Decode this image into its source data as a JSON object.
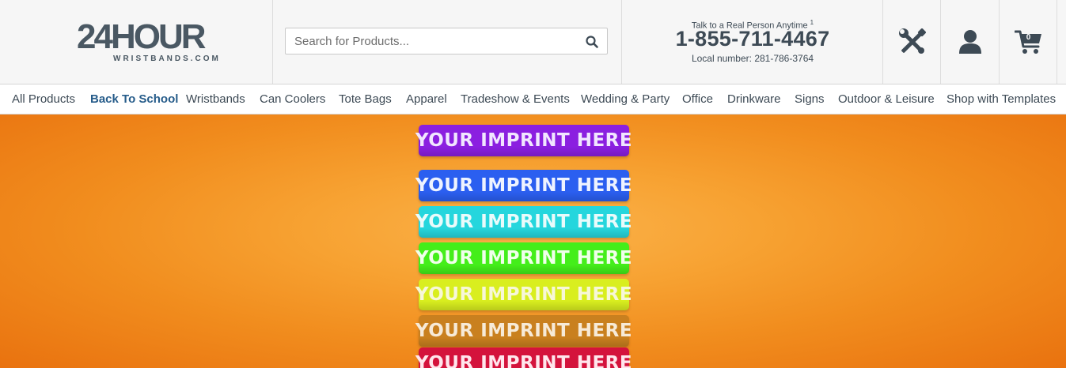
{
  "header": {
    "logo": {
      "main": "24HOUR",
      "sub": "WRISTBANDS.COM"
    },
    "search": {
      "placeholder": "Search for Products..."
    },
    "contact": {
      "tagline": "Talk to a Real Person Anytime",
      "tag_note": "1",
      "phone": "1-855-711-4467",
      "local": "Local number: 281-786-3764"
    },
    "icons": {
      "tools": "tools-icon",
      "account": "user-icon",
      "cart": "cart-icon"
    },
    "cart_count": "0"
  },
  "nav": {
    "items": [
      {
        "label": "All Products"
      },
      {
        "label": "Back To School",
        "active": true
      },
      {
        "label": "Wristbands"
      },
      {
        "label": "Can Coolers"
      },
      {
        "label": "Tote Bags"
      },
      {
        "label": "Apparel"
      },
      {
        "label": "Tradeshow & Events"
      },
      {
        "label": "Wedding & Party"
      },
      {
        "label": "Office"
      },
      {
        "label": "Drinkware"
      },
      {
        "label": "Signs"
      },
      {
        "label": "Outdoor & Leisure"
      },
      {
        "label": "Shop with Templates"
      }
    ]
  },
  "hero": {
    "bands": [
      {
        "text": "YOUR IMPRINT HERE",
        "color": "#8b1fe0",
        "text_color": "#f1e6ff"
      },
      {
        "text": "YOUR IMPRINT HERE",
        "color": "#2b5ff0",
        "text_color": "#eef3ff"
      },
      {
        "text": "YOUR IMPRINT HERE",
        "color": "#25d6dd",
        "text_color": "#e9fbfb"
      },
      {
        "text": "YOUR IMPRINT HERE",
        "color": "#44ee1a",
        "text_color": "#f0ffea"
      },
      {
        "text": "YOUR IMPRINT HERE",
        "color": "#d9ee1f",
        "text_color": "#f7f7d8"
      },
      {
        "text": "YOUR IMPRINT HERE",
        "color": "#c9801f",
        "text_color": "#f7ead7"
      },
      {
        "text": "YOUR IMPRINT HERE",
        "color": "#d4133c",
        "text_color": "#ffe6ec"
      }
    ],
    "colors": {
      "brand": "#3d4a55",
      "accent": "#265c8a",
      "hero_bg": "#f7a232"
    }
  }
}
